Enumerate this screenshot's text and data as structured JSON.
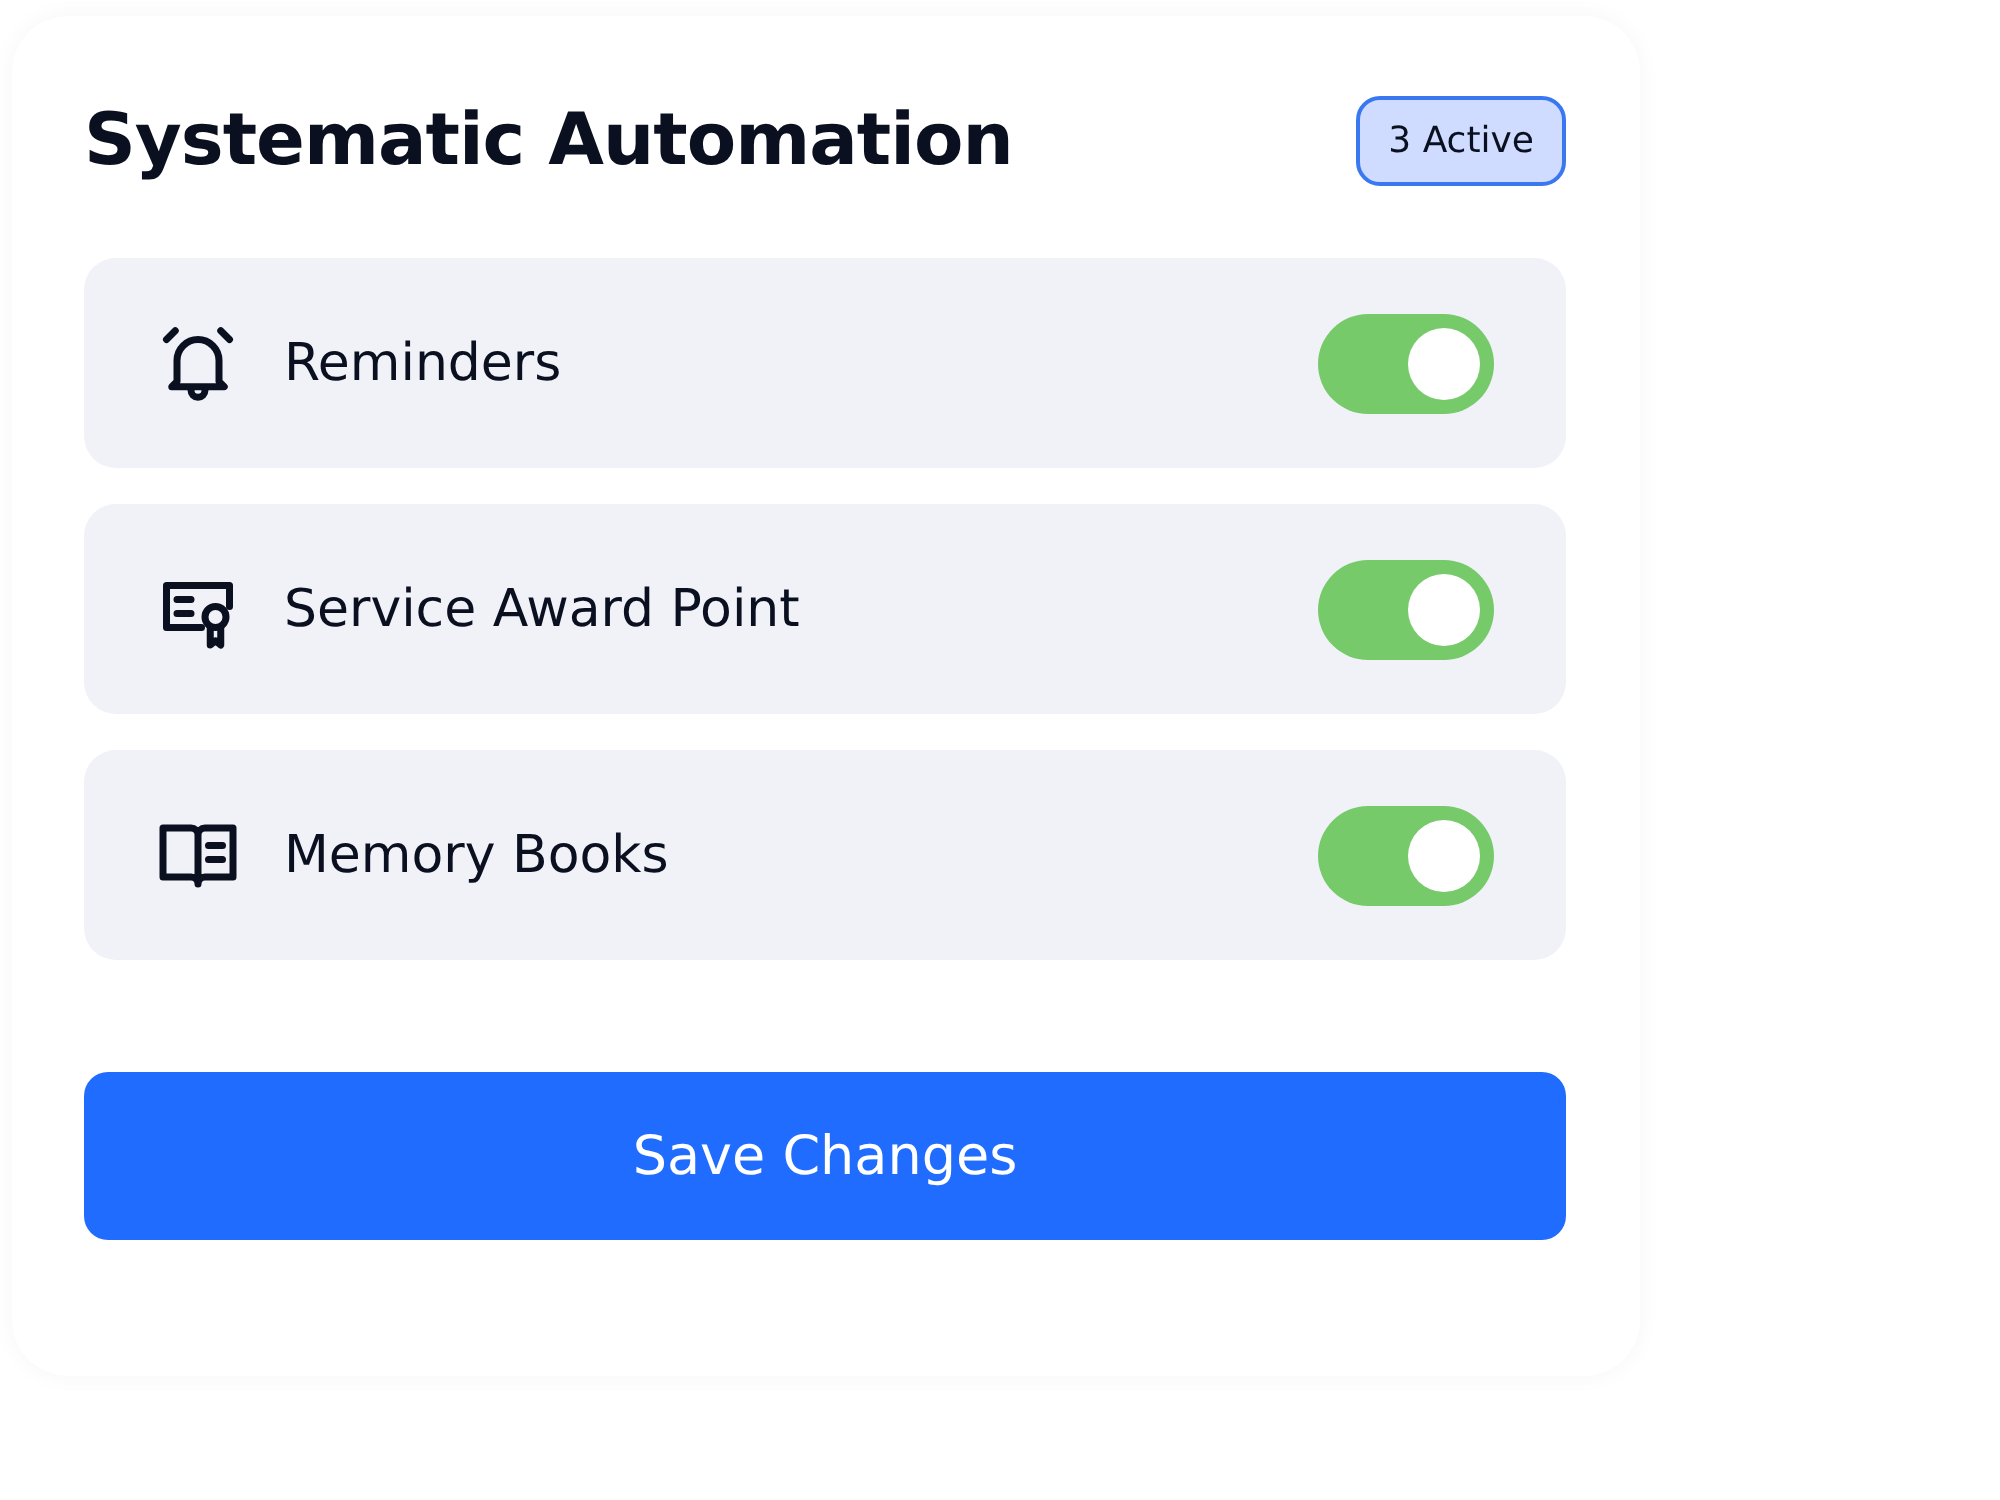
{
  "title": "Systematic Automation",
  "badge": "3 Active",
  "items": [
    {
      "label": "Reminders",
      "on": true
    },
    {
      "label": "Service Award Point",
      "on": true
    },
    {
      "label": "Memory Books",
      "on": true
    }
  ],
  "button": "Save Changes"
}
